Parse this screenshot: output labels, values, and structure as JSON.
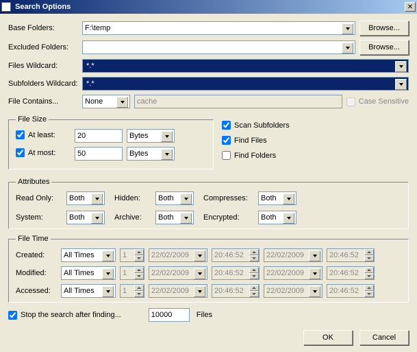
{
  "window": {
    "title": "Search Options"
  },
  "labels": {
    "baseFolders": "Base Folders:",
    "excludedFolders": "Excluded Folders:",
    "filesWildcard": "Files Wildcard:",
    "subfoldersWildcard": "Subfolders Wildcard:",
    "fileContains": "File Contains...",
    "caseSensitive": "Case Sensitive",
    "fileSize": "File Size",
    "atLeast": "At least:",
    "atMost": "At most:",
    "scanSubfolders": "Scan Subfolders",
    "findFiles": "Find Files",
    "findFolders": "Find Folders",
    "attributes": "Attributes",
    "readOnly": "Read Only:",
    "hidden": "Hidden:",
    "compresses": "Compresses:",
    "system": "System:",
    "archive": "Archive:",
    "encrypted": "Encrypted:",
    "fileTime": "File Time",
    "created": "Created:",
    "modified": "Modified:",
    "accessed": "Accessed:",
    "stopSearch": "Stop the search after finding...",
    "files": "Files"
  },
  "buttons": {
    "browse": "Browse...",
    "ok": "OK",
    "cancel": "Cancel"
  },
  "values": {
    "baseFolders": "F:\\temp",
    "excludedFolders": "",
    "filesWildcard": "*.*",
    "subfoldersWildcard": "*.*",
    "fileContains": "None",
    "containsText": "cache",
    "atLeastVal": "20",
    "atMostVal": "50",
    "sizeUnit": "Bytes",
    "attrOption": "Both",
    "timeOption": "All Times",
    "ftNum": "1",
    "ftDate": "22/02/2009",
    "ftTime": "20:46:52",
    "stopCount": "10000"
  },
  "checks": {
    "caseSensitive": false,
    "atLeast": true,
    "atMost": true,
    "scanSubfolders": true,
    "findFiles": true,
    "findFolders": false,
    "stopSearch": true
  }
}
